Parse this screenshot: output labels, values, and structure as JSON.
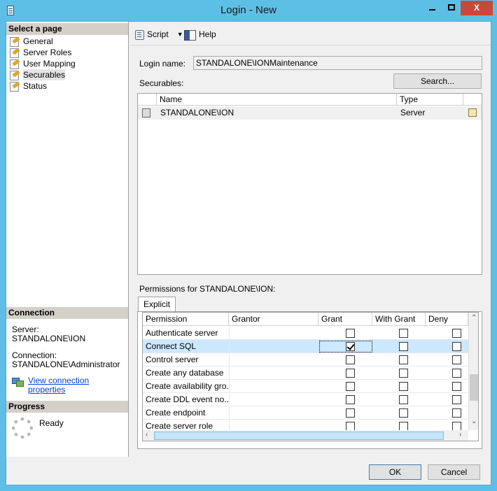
{
  "window": {
    "title": "Login - New",
    "close_label": "X"
  },
  "left": {
    "select_page_header": "Select a page",
    "pages": [
      {
        "label": "General"
      },
      {
        "label": "Server Roles"
      },
      {
        "label": "User Mapping"
      },
      {
        "label": "Securables"
      },
      {
        "label": "Status"
      }
    ],
    "connection_header": "Connection",
    "server_label": "Server:",
    "server_value": "STANDALONE\\ION",
    "connection_label": "Connection:",
    "connection_value": "STANDALONE\\Administrator",
    "view_connection_link": "View connection properties",
    "progress_header": "Progress",
    "progress_status": "Ready"
  },
  "toolbar": {
    "script_label": "Script",
    "help_label": "Help"
  },
  "form": {
    "login_name_label": "Login name:",
    "login_name_value": "STANDALONE\\IONMaintenance",
    "securables_label": "Securables:",
    "search_button": "Search...",
    "securables_columns": [
      "Name",
      "Type"
    ],
    "securables_rows": [
      {
        "name": "STANDALONE\\ION",
        "type": "Server"
      }
    ],
    "permissions_label": "Permissions for STANDALONE\\ION:",
    "tab_explicit": "Explicit"
  },
  "permissions": {
    "columns": [
      "Permission",
      "Grantor",
      "Grant",
      "With Grant",
      "Deny"
    ],
    "rows": [
      {
        "permission": "Authenticate server",
        "grantor": "",
        "grant": false,
        "with_grant": false,
        "deny": false
      },
      {
        "permission": "Connect SQL",
        "grantor": "",
        "grant": true,
        "with_grant": false,
        "deny": false
      },
      {
        "permission": "Control server",
        "grantor": "",
        "grant": false,
        "with_grant": false,
        "deny": false
      },
      {
        "permission": "Create any database",
        "grantor": "",
        "grant": false,
        "with_grant": false,
        "deny": false
      },
      {
        "permission": "Create availability gro...",
        "grantor": "",
        "grant": false,
        "with_grant": false,
        "deny": false
      },
      {
        "permission": "Create DDL event no...",
        "grantor": "",
        "grant": false,
        "with_grant": false,
        "deny": false
      },
      {
        "permission": "Create endpoint",
        "grantor": "",
        "grant": false,
        "with_grant": false,
        "deny": false
      },
      {
        "permission": "Create server role",
        "grantor": "",
        "grant": false,
        "with_grant": false,
        "deny": false
      }
    ]
  },
  "buttons": {
    "ok": "OK",
    "cancel": "Cancel"
  }
}
